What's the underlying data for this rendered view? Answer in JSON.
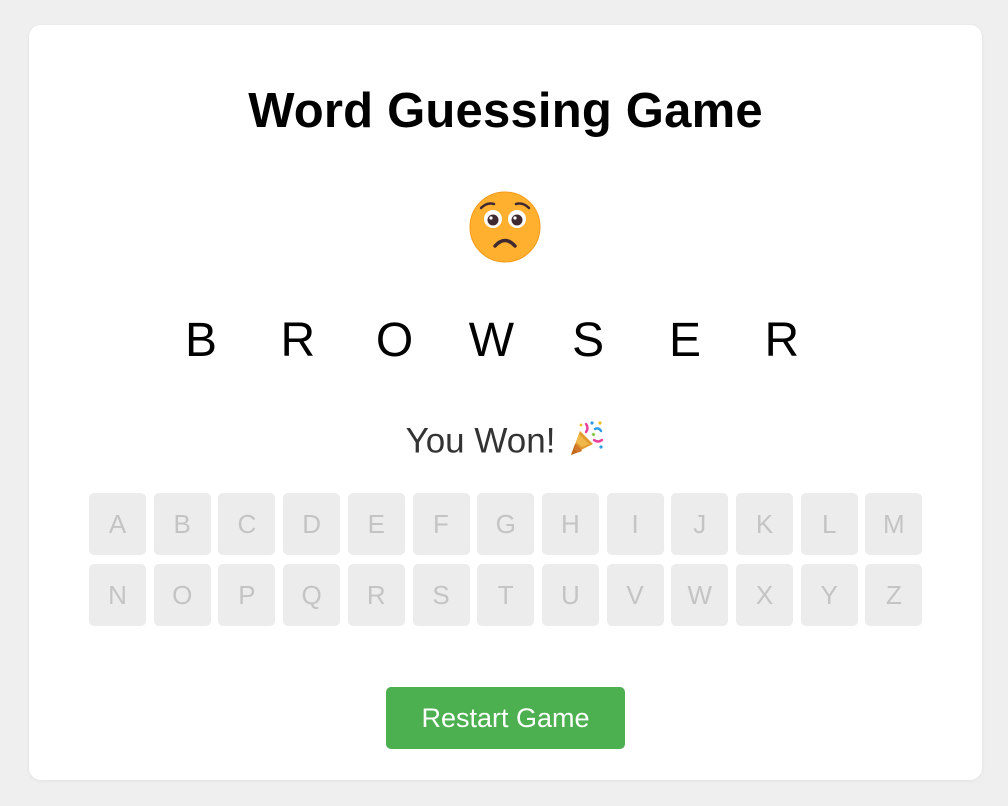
{
  "game": {
    "title": "Word Guessing Game",
    "face_icon": "pleading-face-icon",
    "word_letters": [
      "B",
      "R",
      "O",
      "W",
      "S",
      "E",
      "R"
    ],
    "status": "You Won!",
    "status_icon": "party-popper-icon",
    "keyboard_rows": [
      [
        "A",
        "B",
        "C",
        "D",
        "E",
        "F",
        "G",
        "H",
        "I",
        "J",
        "K",
        "L",
        "M"
      ],
      [
        "N",
        "O",
        "P",
        "Q",
        "R",
        "S",
        "T",
        "U",
        "V",
        "W",
        "X",
        "Y",
        "Z"
      ]
    ],
    "keys_disabled": true,
    "restart_label": "Restart Game"
  },
  "colors": {
    "page_background": "#efefef",
    "card_background": "#ffffff",
    "key_background": "#ececec",
    "key_text": "#c4c4c4",
    "restart_button": "#4caf50"
  }
}
